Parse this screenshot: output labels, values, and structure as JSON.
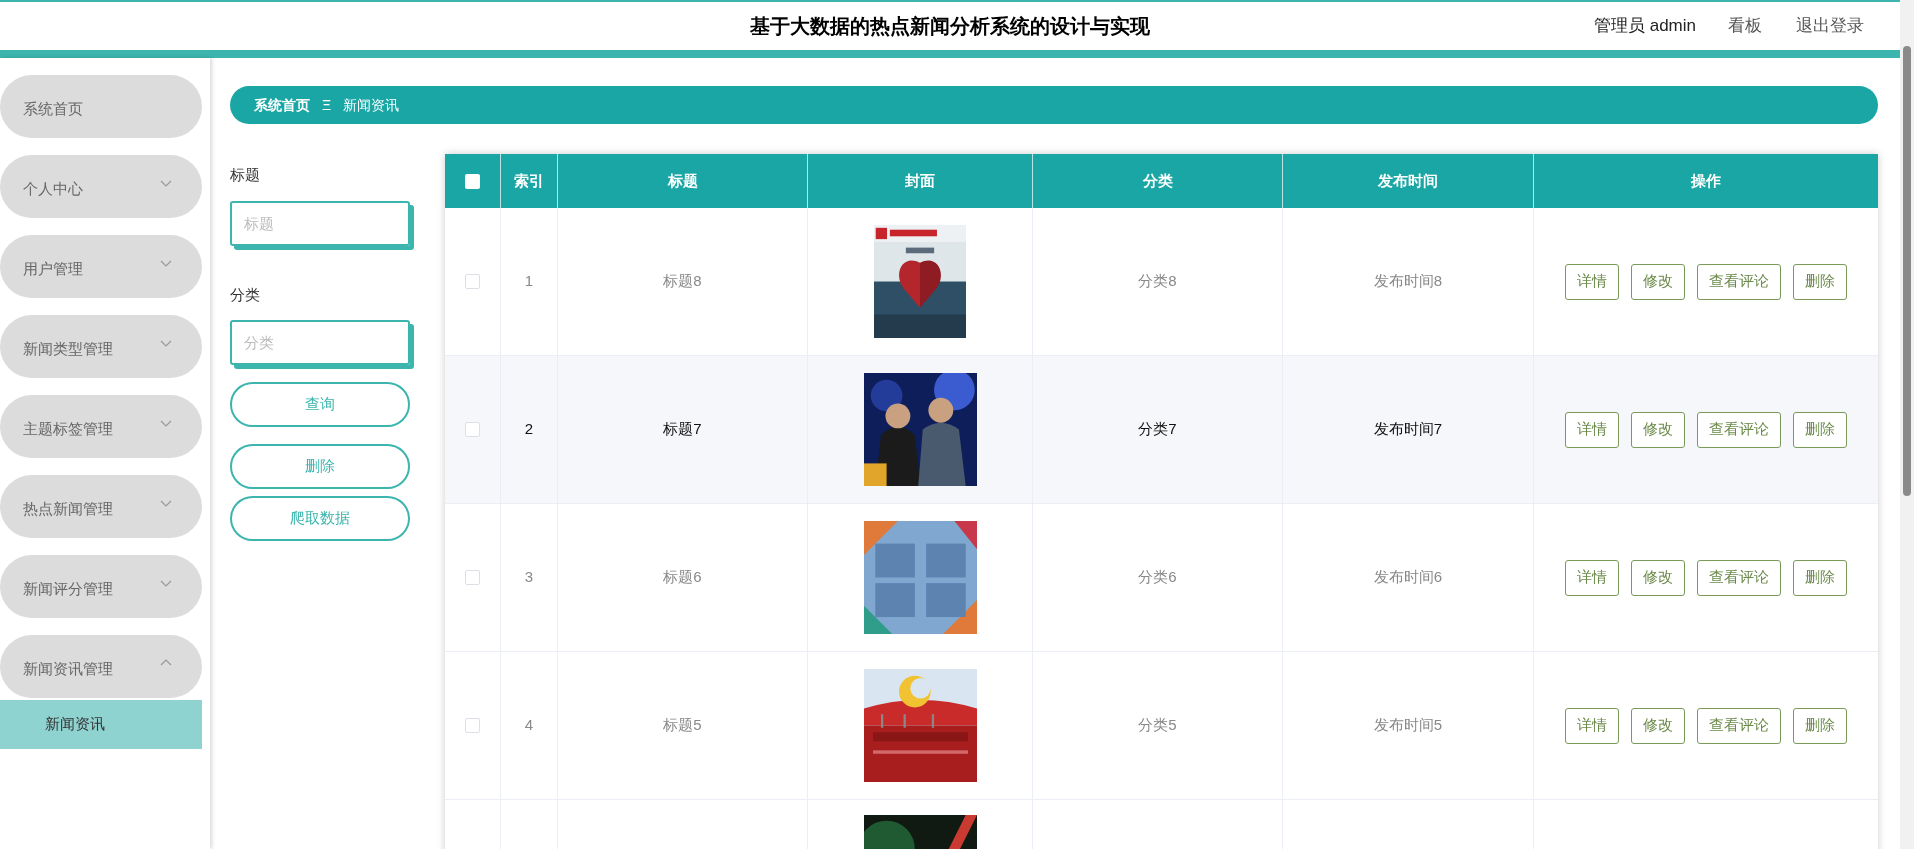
{
  "header": {
    "title": "基于大数据的热点新闻分析系统的设计与实现",
    "user": "管理员 admin",
    "links": [
      "看板",
      "退出登录"
    ]
  },
  "sidebar": {
    "items": [
      {
        "label": "系统首页"
      },
      {
        "label": "个人中心",
        "expanded": false
      },
      {
        "label": "用户管理",
        "expanded": false
      },
      {
        "label": "新闻类型管理",
        "expanded": false
      },
      {
        "label": "主题标签管理",
        "expanded": false
      },
      {
        "label": "热点新闻管理",
        "expanded": false
      },
      {
        "label": "新闻评分管理",
        "expanded": false
      },
      {
        "label": "新闻资讯管理",
        "expanded": true,
        "children": [
          {
            "label": "新闻资讯",
            "selected": true
          }
        ]
      }
    ]
  },
  "breadcrumb": {
    "items": [
      "系统首页",
      "新闻资讯"
    ],
    "separator": "Ξ"
  },
  "filters": [
    {
      "label": "标题",
      "placeholder": "标题"
    },
    {
      "label": "分类",
      "placeholder": "分类"
    }
  ],
  "filter_buttons": [
    "查询",
    "删除",
    "爬取数据"
  ],
  "table": {
    "all_checked": false,
    "columns": [
      "索引",
      "标题",
      "封面",
      "分类",
      "发布时间",
      "操作"
    ],
    "rows": [
      {
        "kind": "full",
        "selected": false,
        "index": "1",
        "title": "标题8",
        "cover": {
          "kind": "picture"
        },
        "category": "分类8",
        "time": "发布时间8",
        "actions": [
          "详情",
          "修改",
          "查看评论",
          "删除"
        ]
      },
      {
        "kind": "full",
        "selected": true,
        "index": "2",
        "title": "标题7",
        "cover": {
          "kind": "picture"
        },
        "category": "分类7",
        "time": "发布时间7",
        "actions": [
          "详情",
          "修改",
          "查看评论",
          "删除"
        ]
      },
      {
        "kind": "full",
        "selected": false,
        "index": "3",
        "title": "标题6",
        "cover": {
          "kind": "picture"
        },
        "category": "分类6",
        "time": "发布时间6",
        "actions": [
          "详情",
          "修改",
          "查看评论",
          "删除"
        ]
      },
      {
        "kind": "full",
        "selected": false,
        "index": "4",
        "title": "标题5",
        "cover": {
          "kind": "picture"
        },
        "category": "分类5",
        "time": "发布时间5",
        "actions": [
          "详情",
          "修改",
          "查看评论",
          "删除"
        ]
      },
      {
        "kind": "cut",
        "cover": {
          "kind": "picture"
        }
      }
    ]
  }
}
